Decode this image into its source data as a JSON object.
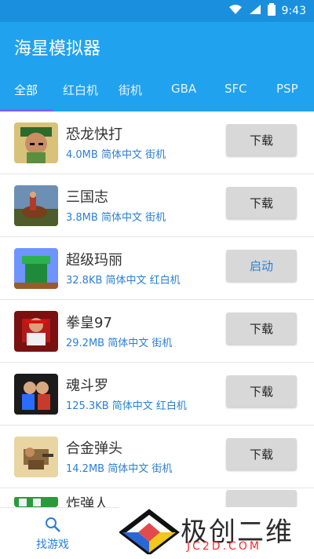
{
  "status": {
    "time": "9:43"
  },
  "app": {
    "title": "海星模拟器"
  },
  "tabs": [
    {
      "label": "全部"
    },
    {
      "label": "红白机"
    },
    {
      "label": "街机"
    },
    {
      "label": "GBA"
    },
    {
      "label": "SFC"
    },
    {
      "label": "PSP"
    }
  ],
  "games": [
    {
      "name": "恐龙快打",
      "meta": "4.0MB 简体中文 街机",
      "action": "下载",
      "icon": "soldier-icon"
    },
    {
      "name": "三国志",
      "meta": "3.8MB 简体中文 街机",
      "action": "下载",
      "icon": "horse-rider-icon"
    },
    {
      "name": "超级玛丽",
      "meta": "32.8KB 简体中文 红白机",
      "action": "启动",
      "icon": "pipe-icon"
    },
    {
      "name": "拳皇97",
      "meta": "29.2MB 简体中文 街机",
      "action": "下载",
      "icon": "fighter-icon"
    },
    {
      "name": "魂斗罗",
      "meta": "125.3KB 简体中文 红白机",
      "action": "下载",
      "icon": "commando-icon"
    },
    {
      "name": "合金弹头",
      "meta": "14.2MB 简体中文 街机",
      "action": "下载",
      "icon": "metal-slug-icon"
    }
  ],
  "peek": {
    "name": "炸弹人"
  },
  "bottom": {
    "label": "找游戏"
  },
  "watermark": {
    "main": "极创二维",
    "sub": "JC2D.COM"
  }
}
